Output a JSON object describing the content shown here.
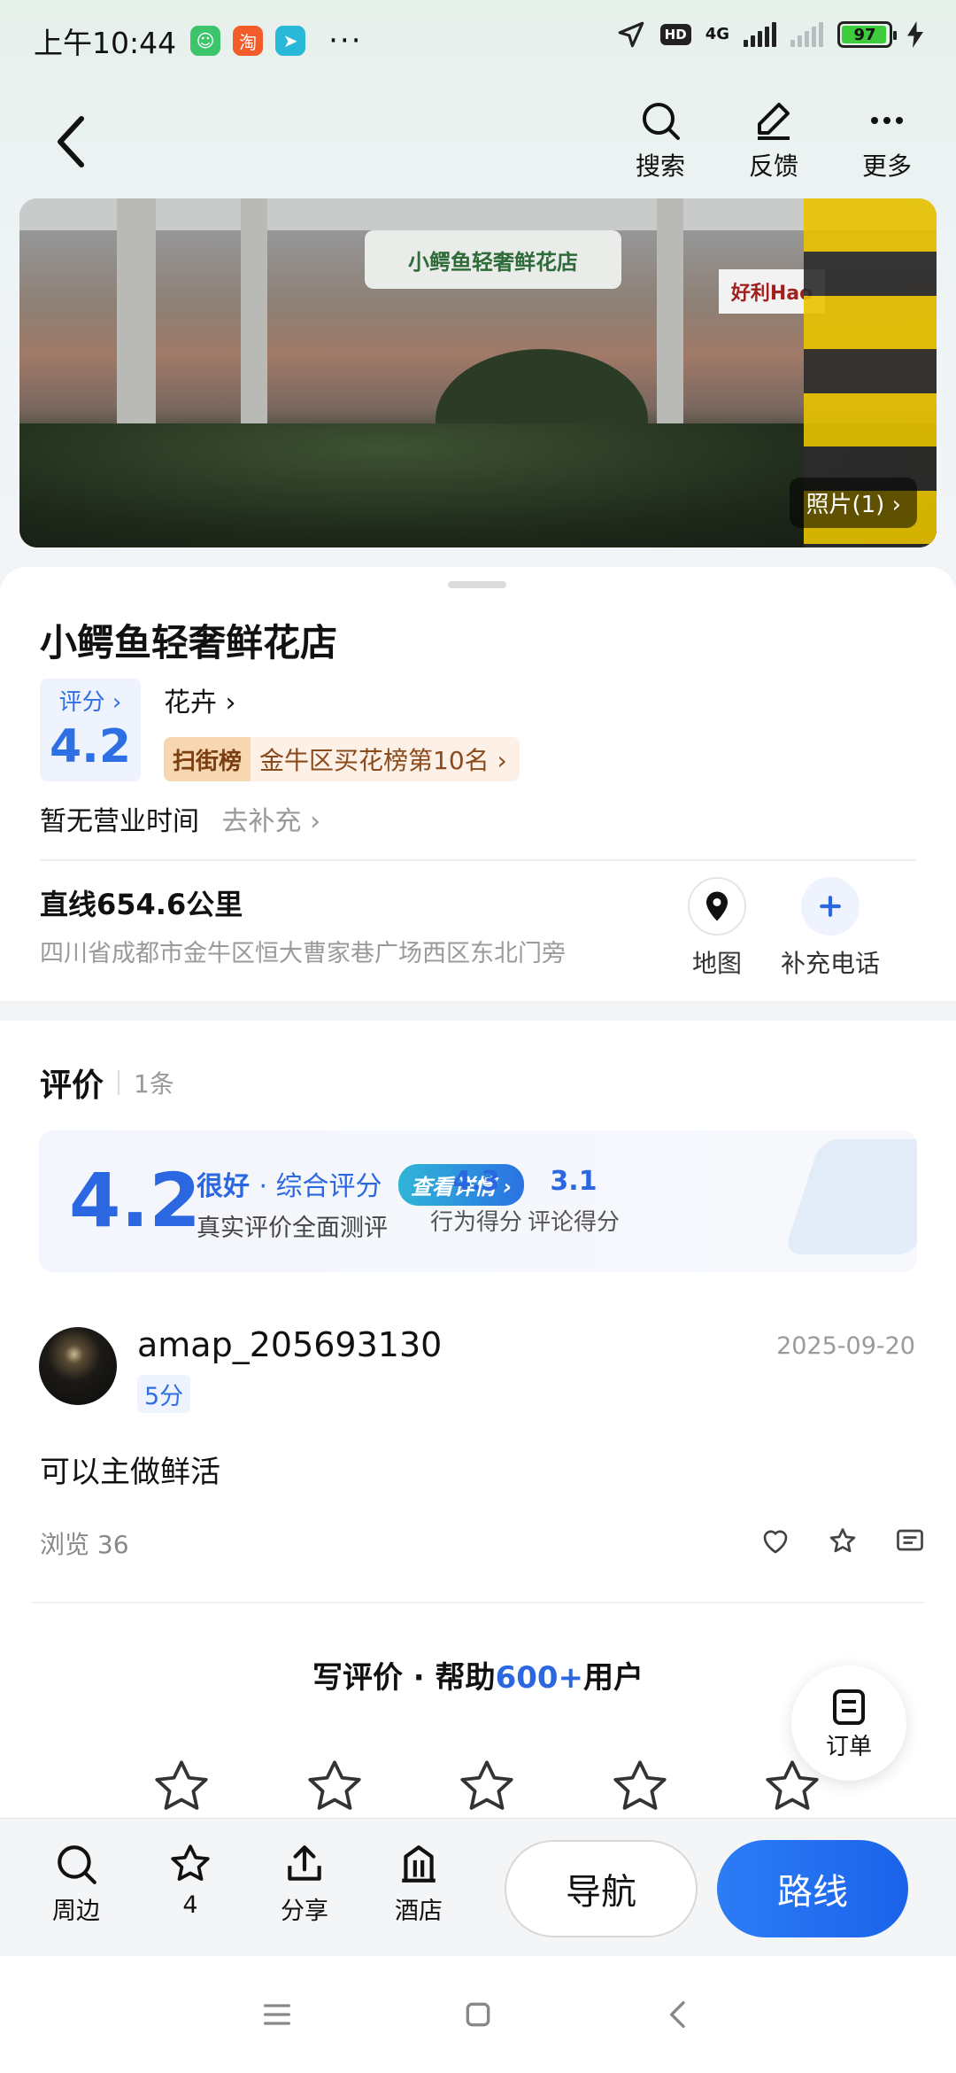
{
  "status_bar": {
    "time": "上午10:44",
    "more": "···",
    "hd": "HD",
    "network": "4G",
    "battery": "97"
  },
  "nav": {
    "search_label": "搜索",
    "feedback_label": "反馈",
    "more_label": "更多"
  },
  "photo": {
    "shop_sign": "小鳄鱼轻奢鲜花店",
    "right_sign": "好利Hao",
    "count_label": "照片(1)"
  },
  "poi": {
    "title": "小鳄鱼轻奢鲜花店",
    "rating_label": "评分",
    "rating_value": "4.2",
    "category": "花卉",
    "rank_tag": "扫街榜",
    "rank_text": "金牛区买花榜第10名",
    "hours": "暂无营业时间",
    "hours_link": "去补充",
    "distance": "直线654.6公里",
    "address": "四川省成都市金牛区恒大曹家巷广场西区东北门旁",
    "map_label": "地图",
    "add_phone_label": "补充电话"
  },
  "reviews": {
    "title": "评价",
    "count": "1条",
    "score": "4.2",
    "quality": "很好",
    "overall": "· 综合评分",
    "detail_btn": "查看详情",
    "subtitle": "真实评价全面测评",
    "metrics": [
      {
        "value": "4.3",
        "label": "行为得分"
      },
      {
        "value": "3.1",
        "label": "评论得分"
      }
    ],
    "items": [
      {
        "user": "amap_205693130",
        "score": "5分",
        "date": "2025-09-20",
        "text": "可以主做鲜活",
        "views": "浏览 36"
      }
    ],
    "cta_prefix": "写评价 · 帮助",
    "cta_highlight": "600+",
    "cta_suffix": "用户"
  },
  "floating": {
    "order_label": "订单"
  },
  "bottom_bar": {
    "nearby": "周边",
    "favorites": "4",
    "share": "分享",
    "hotel": "酒店",
    "navigate": "导航",
    "route": "路线"
  },
  "colors": {
    "accent": "#2c67e2",
    "route_button": "#1a63ea",
    "rank_bg": "#fdf0e6"
  }
}
